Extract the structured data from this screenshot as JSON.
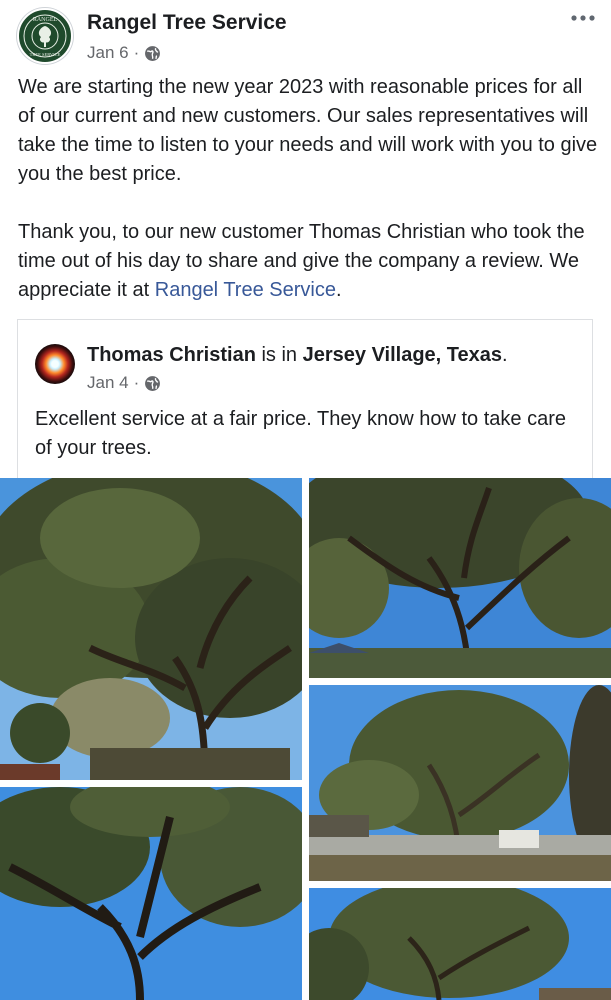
{
  "post": {
    "page_name": "Rangel Tree Service",
    "logo_text_top": "RANGEL",
    "logo_text_bottom": "TREE SERVICE",
    "date": "Jan 6",
    "separator": "·",
    "privacy_icon": "globe-icon",
    "more_icon": "more-options-icon",
    "paragraph_1": "We are starting the new year 2023 with reasonable prices for all of our current and new customers. Our sales representatives will take the time to listen to your needs and will work with you to give you the best price.",
    "paragraph_2_text": "Thank you, to our new customer Thomas Christian who took the time out of his day to share and give the company a review. We appreciate it at ",
    "paragraph_2_link": "Rangel Tree Service",
    "paragraph_2_end": "."
  },
  "shared_post": {
    "author": "Thomas Christian",
    "connector": " is in ",
    "location": "Jersey Village, Texas",
    "location_end": ".",
    "date": "Jan 4",
    "separator": "·",
    "privacy_icon": "globe-icon",
    "text": "Excellent service at a fair price.  They know how to take care of your trees."
  },
  "photos": [
    {
      "name": "tree-photo-1"
    },
    {
      "name": "tree-photo-2"
    },
    {
      "name": "tree-photo-3"
    },
    {
      "name": "tree-photo-4"
    },
    {
      "name": "tree-photo-5"
    }
  ],
  "colors": {
    "text": "#1c1e21",
    "secondary_text": "#65676b",
    "link": "#385898",
    "border": "#dddfe2",
    "sky": "#3f8fe0",
    "foliage": "#3d4a2c"
  }
}
